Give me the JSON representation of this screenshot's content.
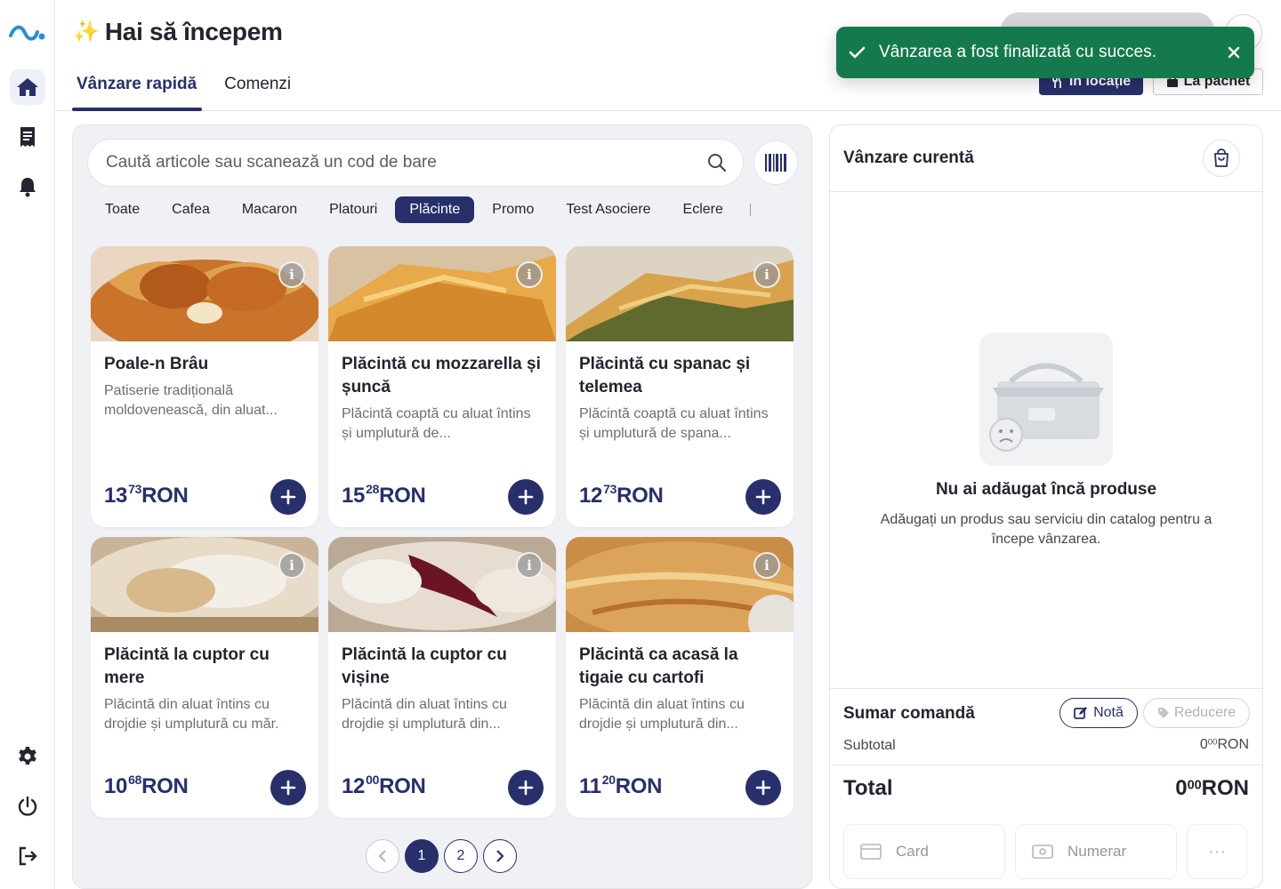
{
  "header": {
    "title": "Hai să începem",
    "sparkle": "✨",
    "tabs": [
      {
        "label": "Vânzare rapidă",
        "active": true
      },
      {
        "label": "Comenzi",
        "active": false
      }
    ],
    "dine_in_label": "În locație",
    "takeaway_label": "La pachet"
  },
  "toast": {
    "message": "Vânzarea a fost finalizată cu succes.",
    "color": "#147a4d"
  },
  "catalog": {
    "search_placeholder": "Caută articole sau scanează un cod de bare",
    "categories": [
      "Toate",
      "Cafea",
      "Macaron",
      "Platouri",
      "Plăcinte",
      "Promo",
      "Test Asociere",
      "Eclere"
    ],
    "active_category": "Plăcinte",
    "products": [
      {
        "name": "Poale-n Brâu",
        "description": "Patiserie tradițională moldovenească, din aluat...",
        "price_int": "13",
        "price_dec": "73",
        "currency": "RON"
      },
      {
        "name": "Plăcintă cu mozzarella și șuncă",
        "description": "Plăcintă coaptă cu aluat întins și umplutură de...",
        "price_int": "15",
        "price_dec": "28",
        "currency": "RON"
      },
      {
        "name": "Plăcintă cu spanac și telemea",
        "description": "Plăcintă coaptă cu aluat întins și umplutură de spana...",
        "price_int": "12",
        "price_dec": "73",
        "currency": "RON"
      },
      {
        "name": "Plăcintă la cuptor cu mere",
        "description": "Plăcintă din aluat întins cu drojdie și umplutură cu măr.",
        "price_int": "10",
        "price_dec": "68",
        "currency": "RON"
      },
      {
        "name": "Plăcintă la cuptor cu vișine",
        "description": "Plăcintă din aluat întins cu drojdie și umplutură din...",
        "price_int": "12",
        "price_dec": "00",
        "currency": "RON"
      },
      {
        "name": "Plăcintă ca acasă la tigaie cu cartofi",
        "description": "Plăcintă din aluat întins cu drojdie și umplutură din...",
        "price_int": "11",
        "price_dec": "20",
        "currency": "RON"
      }
    ],
    "pagination": {
      "pages": [
        "1",
        "2"
      ],
      "current": "1"
    }
  },
  "sale": {
    "title": "Vânzare curentă",
    "empty_title": "Nu ai adăugat încă produse",
    "empty_subtitle": "Adăugați un produs sau serviciu din catalog pentru a începe vânzarea.",
    "summary_title": "Sumar comandă",
    "note_label": "Notă",
    "discount_label": "Reducere",
    "subtotal_label": "Subtotal",
    "subtotal_int": "0",
    "subtotal_dec": "00",
    "total_label": "Total",
    "total_int": "0",
    "total_dec": "00",
    "currency": "RON",
    "pay_card_label": "Card",
    "pay_cash_label": "Numerar",
    "more_label": "···"
  },
  "colors": {
    "accent": "#27306b",
    "brand_logo": "#2a8fd0",
    "success": "#147a4d"
  },
  "icons": {
    "rail": [
      "logo-wave-icon",
      "home-icon",
      "receipt-icon",
      "bell-icon",
      "settings-gear-icon",
      "power-icon",
      "logout-icon"
    ]
  }
}
